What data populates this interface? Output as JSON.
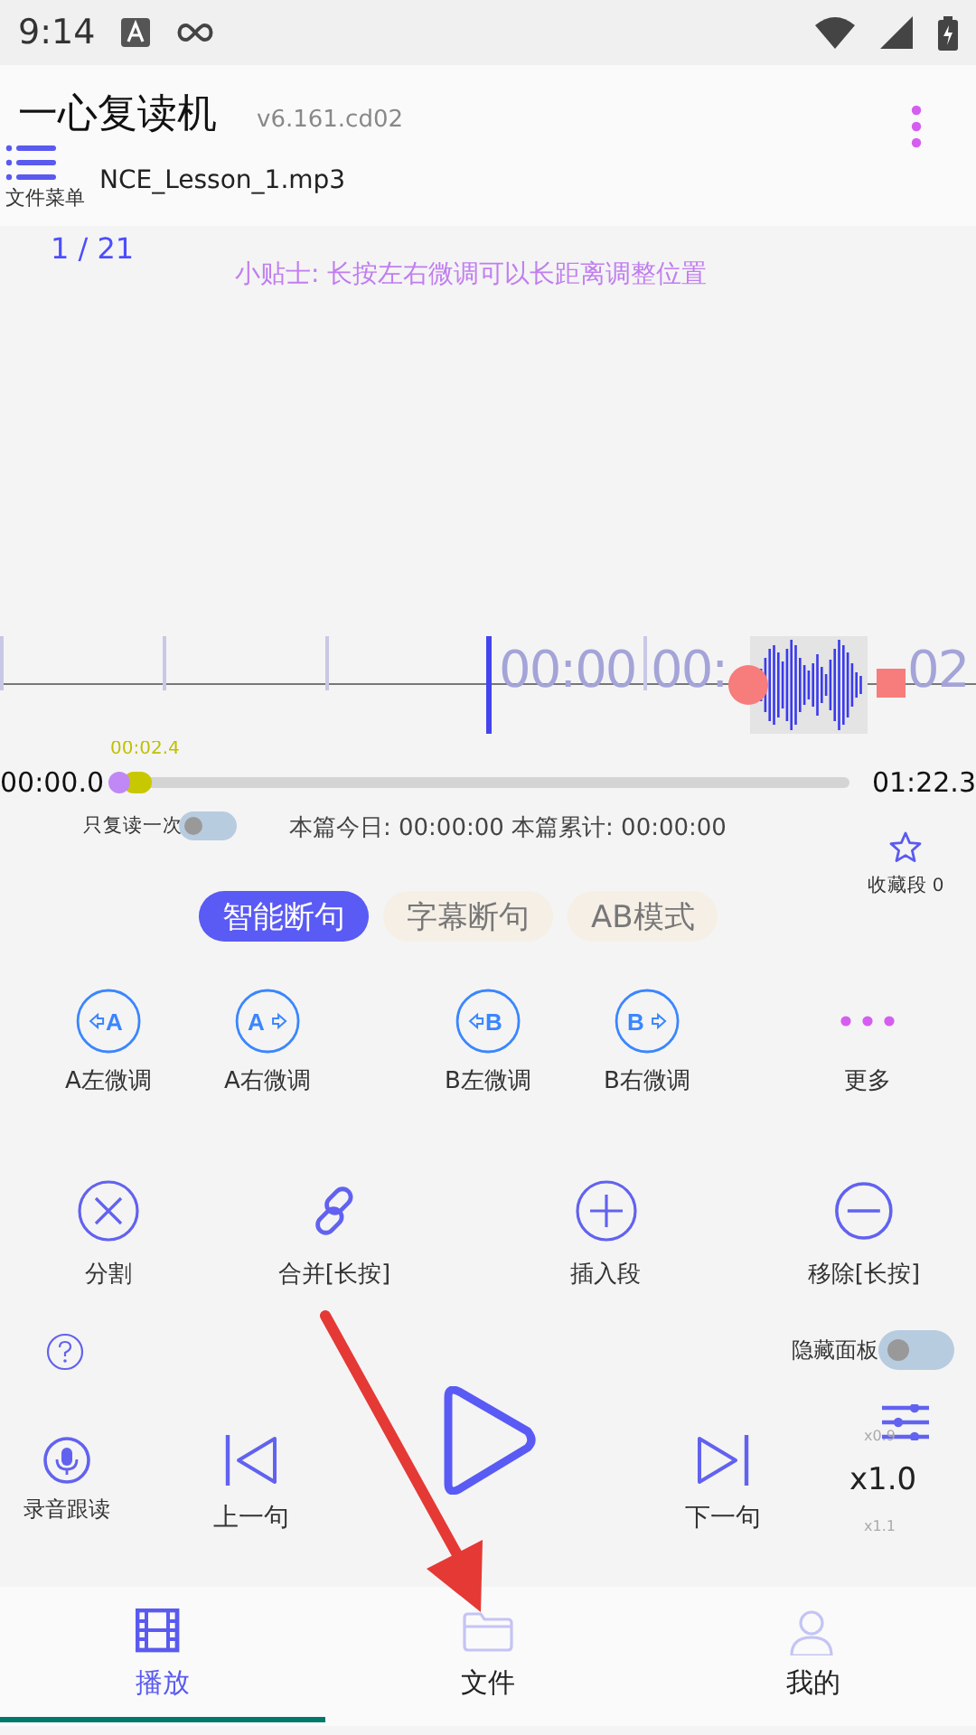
{
  "status_bar": {
    "time": "9:14"
  },
  "app_bar": {
    "title": "一心复读机",
    "version": "v6.161.cd02"
  },
  "file_menu": {
    "label": "文件菜单"
  },
  "file_name": "NCE_Lesson_1.mp3",
  "segment_counter": "1 / 21",
  "tip": "小贴士: 长按左右微调可以长距离调整位置",
  "waveform": {
    "time_labels": [
      "00:00",
      "00:",
      "02"
    ]
  },
  "progress": {
    "marker_time": "00:02.4",
    "start": "00:00.0",
    "end": "01:22.3",
    "level": 0
  },
  "repeat_once": {
    "label": "只复读一次",
    "on": false
  },
  "stats": "本篇今日: 00:00:00 本篇累计: 00:00:00",
  "favorite": {
    "label": "收藏段 0"
  },
  "modes": [
    {
      "label": "智能断句",
      "selected": true
    },
    {
      "label": "字幕断句",
      "selected": false
    },
    {
      "label": "AB模式",
      "selected": false
    }
  ],
  "adjust_buttons": [
    {
      "kind": "a-left",
      "icon_letter": "A",
      "label": "A左微调"
    },
    {
      "kind": "a-right",
      "icon_letter": "A",
      "label": "A右微调"
    },
    {
      "kind": "b-left",
      "icon_letter": "B",
      "label": "B左微调"
    },
    {
      "kind": "b-right",
      "icon_letter": "B",
      "label": "B右微调"
    },
    {
      "kind": "more",
      "label": "更多"
    }
  ],
  "edit_buttons": [
    {
      "kind": "split",
      "label": "分割"
    },
    {
      "kind": "merge",
      "label": "合并[长按]"
    },
    {
      "kind": "insert",
      "label": "插入段"
    },
    {
      "kind": "remove",
      "label": "移除[长按]"
    }
  ],
  "hide_panel": {
    "label": "隐藏面板",
    "on": false
  },
  "player": {
    "record_label": "录音跟读",
    "prev_label": "上一句",
    "next_label": "下一句",
    "speed": {
      "slower": "x0.9",
      "current": "x1.0",
      "faster": "x1.1"
    }
  },
  "bottom_nav": [
    {
      "kind": "play",
      "label": "播放",
      "selected": true
    },
    {
      "kind": "files",
      "label": "文件",
      "selected": false
    },
    {
      "kind": "profile",
      "label": "我的",
      "selected": false
    }
  ]
}
